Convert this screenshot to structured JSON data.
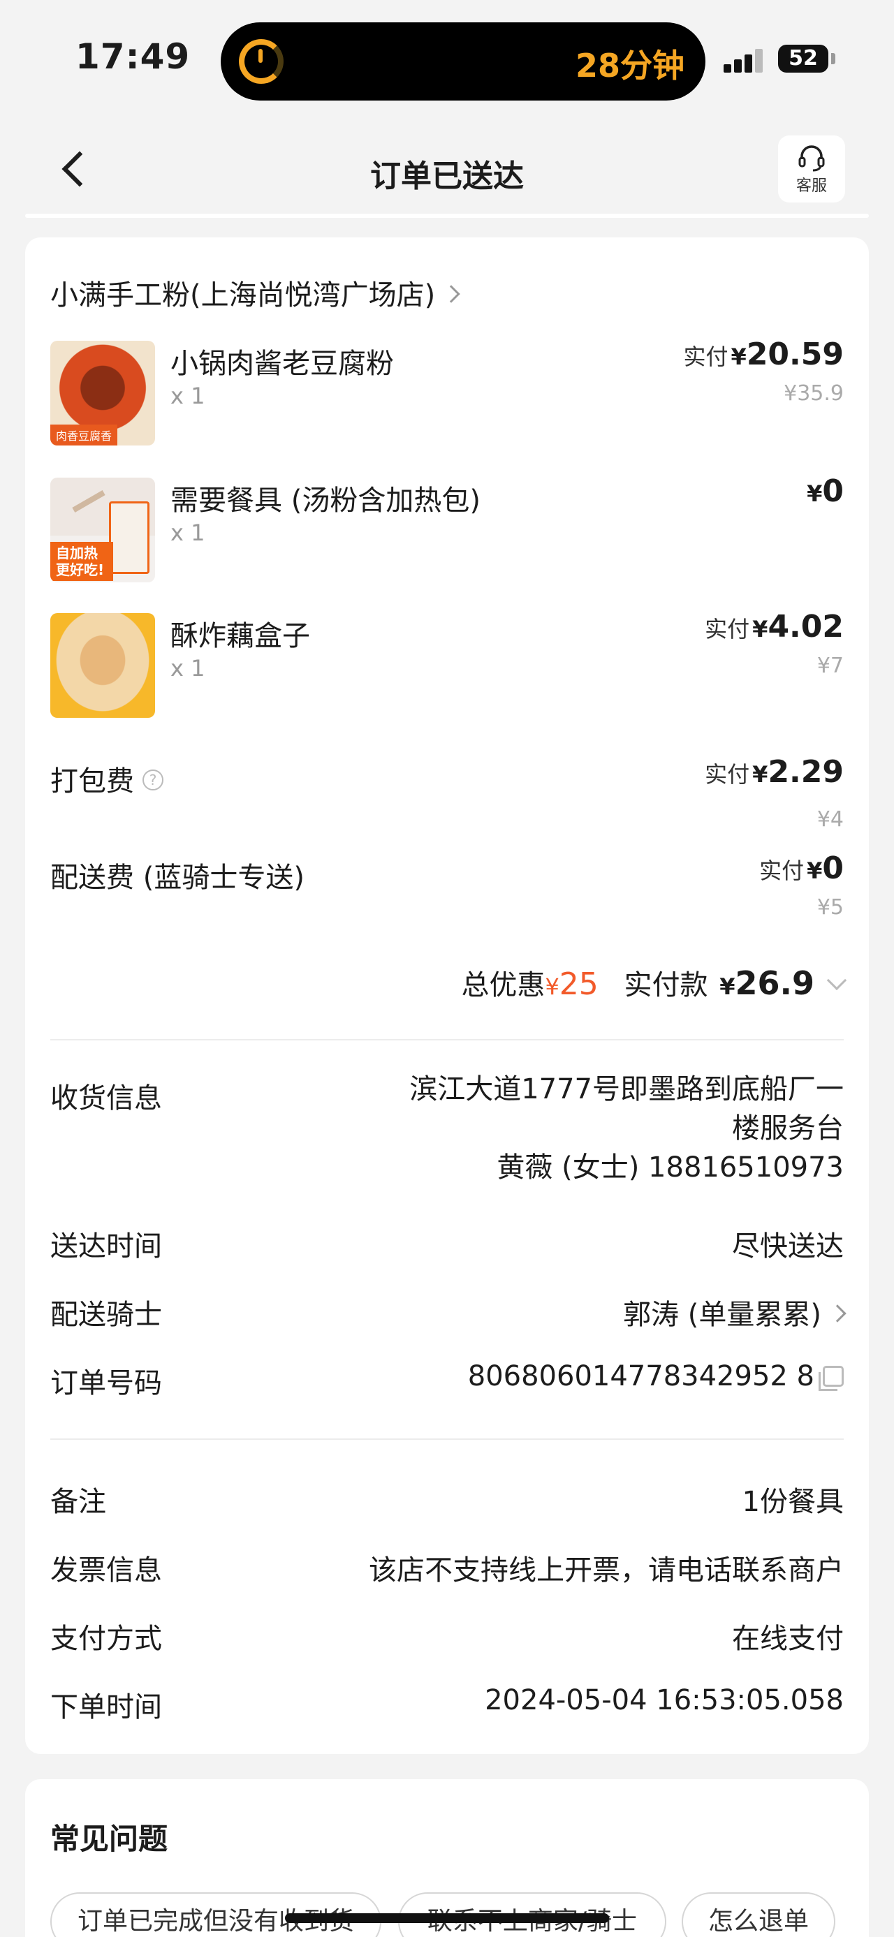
{
  "status": {
    "time": "17:49",
    "island_text": "28分钟",
    "battery": "52"
  },
  "header": {
    "title": "订单已送达",
    "service_label": "客服"
  },
  "store": {
    "name": "小满手工粉(上海尚悦湾广场店)"
  },
  "items": [
    {
      "name": "小锅肉酱老豆腐粉",
      "qty": "x 1",
      "pay_label": "实付",
      "price": "20.59",
      "orig": "¥35.9",
      "thumb_tag": "肉香豆腐香"
    },
    {
      "name": "需要餐具 (汤粉含加热包)",
      "qty": "x 1",
      "pay_label": "",
      "price": "0",
      "orig": "",
      "thumb_tag": "自加热 更好吃!"
    },
    {
      "name": "酥炸藕盒子",
      "qty": "x 1",
      "pay_label": "实付",
      "price": "4.02",
      "orig": "¥7",
      "thumb_tag": ""
    }
  ],
  "fees": {
    "packing_label": "打包费",
    "packing_pay_label": "实付",
    "packing_price": "2.29",
    "packing_orig": "¥4",
    "delivery_label": "配送费 (蓝骑士专送)",
    "delivery_pay_label": "实付",
    "delivery_price": "0",
    "delivery_orig": "¥5"
  },
  "summary": {
    "discount_label": "总优惠",
    "discount_value": "25",
    "total_label": "实付款",
    "total_value": "26.9"
  },
  "delivery_info": {
    "address_label": "收货信息",
    "address_line1": "滨江大道1777号即墨路到底船厂一",
    "address_line2": "楼服务台",
    "contact": "黄薇 (女士) 18816510973",
    "time_label": "送达时间",
    "time_value": "尽快送达",
    "rider_label": "配送骑士",
    "rider_value": "郭涛 (单量累累)",
    "order_no_label": "订单号码",
    "order_no_value": "806806014778342952 8"
  },
  "order_info": {
    "remark_label": "备注",
    "remark_value": "1份餐具",
    "invoice_label": "发票信息",
    "invoice_value": "该店不支持线上开票，请电话联系商户",
    "payment_label": "支付方式",
    "payment_value": "在线支付",
    "order_time_label": "下单时间",
    "order_time_value": "2024-05-04 16:53:05.058"
  },
  "faq": {
    "title": "常见问题",
    "chips": [
      "订单已完成但没有收到货",
      "联系不上商家/骑士",
      "怎么退单"
    ]
  },
  "colors": {
    "accent_orange": "#f25a2a",
    "island_orange": "#f5a623"
  },
  "symbols": {
    "yen": "¥",
    "help": "?"
  }
}
